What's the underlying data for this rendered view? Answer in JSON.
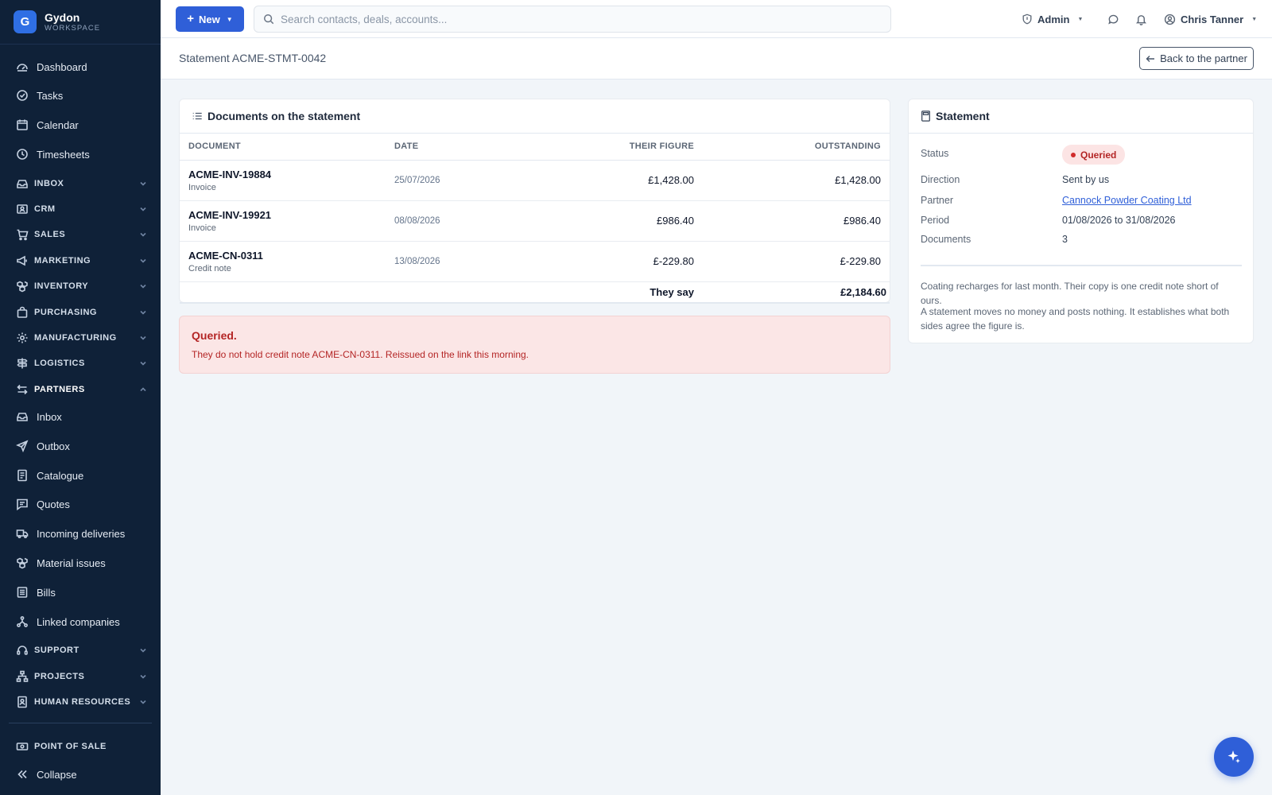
{
  "brand": {
    "logo_letter": "G",
    "name": "Gydon",
    "sub": "WORKSPACE"
  },
  "sidebar": {
    "items": [
      {
        "label": "Dashboard",
        "icon": "dashboard-icon"
      },
      {
        "label": "Tasks",
        "icon": "check-circle-icon"
      },
      {
        "label": "Calendar",
        "icon": "calendar-icon"
      },
      {
        "label": "Timesheets",
        "icon": "clock-icon"
      }
    ],
    "groups": [
      {
        "label": "INBOX",
        "icon": "inbox-icon",
        "expanded": false
      },
      {
        "label": "CRM",
        "icon": "contact-card-icon",
        "expanded": false
      },
      {
        "label": "SALES",
        "icon": "cart-icon",
        "expanded": false
      },
      {
        "label": "MARKETING",
        "icon": "megaphone-icon",
        "expanded": false
      },
      {
        "label": "INVENTORY",
        "icon": "boxes-icon",
        "expanded": false
      },
      {
        "label": "PURCHASING",
        "icon": "bag-icon",
        "expanded": false
      },
      {
        "label": "MANUFACTURING",
        "icon": "gear-icon",
        "expanded": false
      },
      {
        "label": "LOGISTICS",
        "icon": "signpost-icon",
        "expanded": false
      },
      {
        "label": "PARTNERS",
        "icon": "arrows-swap-icon",
        "expanded": true
      }
    ],
    "partner_items": [
      {
        "label": "Inbox",
        "icon": "inbox-icon"
      },
      {
        "label": "Outbox",
        "icon": "send-icon"
      },
      {
        "label": "Catalogue",
        "icon": "catalogue-icon"
      },
      {
        "label": "Quotes",
        "icon": "message-square-icon"
      },
      {
        "label": "Incoming deliveries",
        "icon": "truck-icon"
      },
      {
        "label": "Material issues",
        "icon": "boxes-icon"
      },
      {
        "label": "Bills",
        "icon": "bill-icon"
      },
      {
        "label": "Linked companies",
        "icon": "network-icon"
      }
    ],
    "groups_bottom": [
      {
        "label": "SUPPORT",
        "icon": "headset-icon",
        "expanded": false
      },
      {
        "label": "PROJECTS",
        "icon": "project-tree-icon",
        "expanded": false
      },
      {
        "label": "HUMAN RESOURCES",
        "icon": "badge-person-icon",
        "expanded": false
      }
    ],
    "pos_label": "POINT OF SALE",
    "collapse_label": "Collapse"
  },
  "topbar": {
    "new_label": "New",
    "search_placeholder": "Search contacts, deals, accounts...",
    "admin_label": "Admin",
    "user_name": "Chris Tanner"
  },
  "page": {
    "title": "Statement ACME-STMT-0042",
    "back_label": "Back to the partner"
  },
  "documents": {
    "title": "Documents on the statement",
    "columns": [
      "DOCUMENT",
      "DATE",
      "THEIR FIGURE",
      "OUTSTANDING"
    ],
    "rows": [
      {
        "id": "ACME-INV-19884",
        "type": "Invoice",
        "date": "25/07/2026",
        "their_figure": "£1,428.00",
        "outstanding": "£1,428.00"
      },
      {
        "id": "ACME-INV-19921",
        "type": "Invoice",
        "date": "08/08/2026",
        "their_figure": "£986.40",
        "outstanding": "£986.40"
      },
      {
        "id": "ACME-CN-0311",
        "type": "Credit note",
        "date": "13/08/2026",
        "their_figure": "£-229.80",
        "outstanding": "£-229.80"
      }
    ],
    "total_label": "They say",
    "total_value": "£2,184.60"
  },
  "alert": {
    "title": "Queried.",
    "text": "They do not hold credit note ACME-CN-0311. Reissued on the link this morning."
  },
  "statement": {
    "title": "Statement",
    "status_label": "Status",
    "status_value": "Queried",
    "direction_label": "Direction",
    "direction_value": "Sent by us",
    "partner_label": "Partner",
    "partner_value": "Cannock Powder Coating Ltd",
    "period_label": "Period",
    "period_value": "01/08/2026 to 31/08/2026",
    "documents_label": "Documents",
    "documents_value": "3",
    "note1": "Coating recharges for last month. Their copy is one credit note short of ours.",
    "note2": "A statement moves no money and posts nothing. It establishes what both sides agree the figure is."
  },
  "colors": {
    "sidebar_bg": "#0f2138",
    "accent": "#2f5fd8",
    "danger": "#b42525",
    "danger_bg": "#fbe6e6"
  }
}
